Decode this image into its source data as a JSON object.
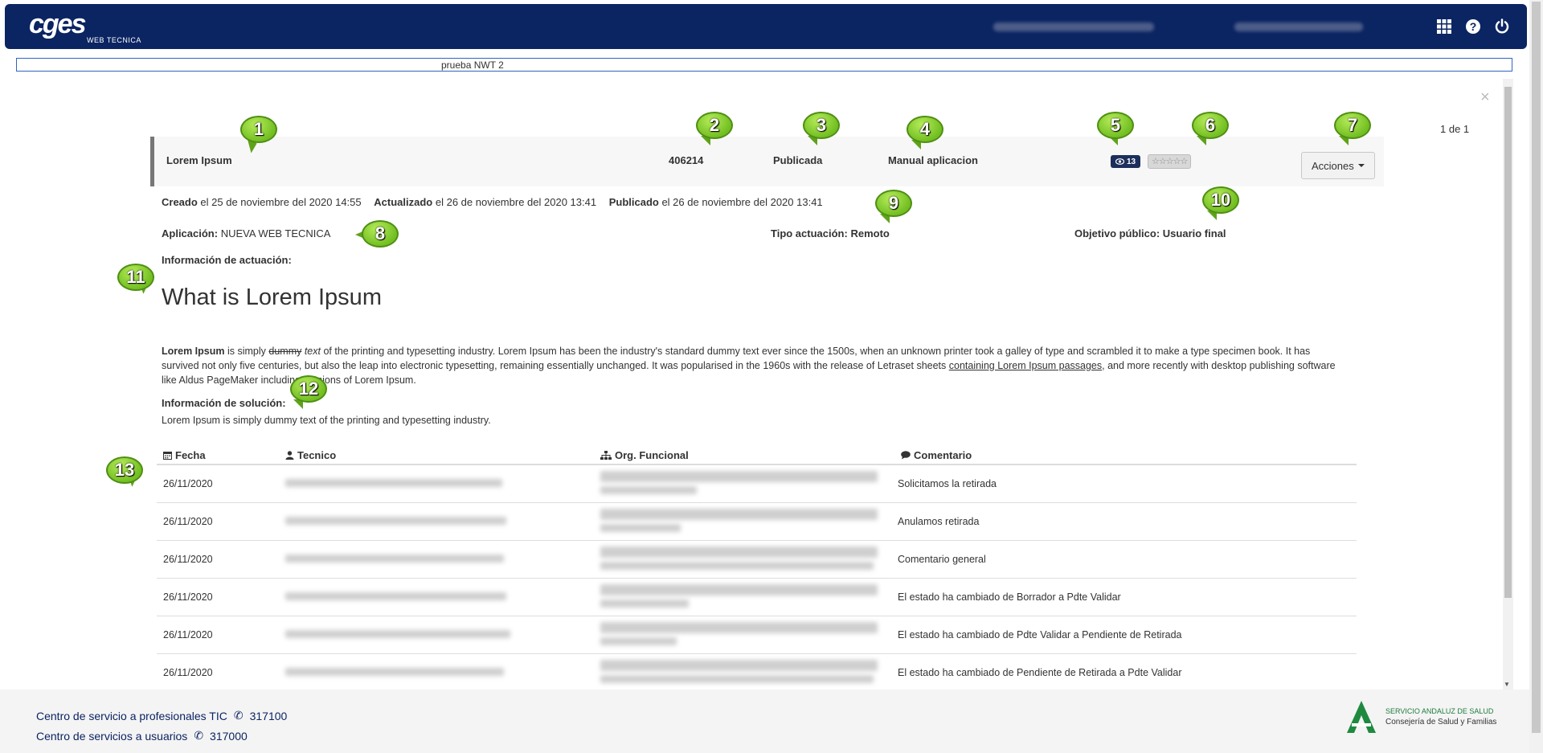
{
  "header": {
    "logo_main": "cges",
    "logo_sub": "WEB TECNICA",
    "icons": [
      "grid-icon",
      "help-icon",
      "power-icon"
    ]
  },
  "subtitle": "prueba NWT 2",
  "pager": "1 de 1",
  "close_label": "×",
  "summary": {
    "title": "Lorem Ipsum",
    "id": "406214",
    "status": "Publicada",
    "type": "Manual aplicacion",
    "views": "13",
    "stars": "☆☆☆☆☆",
    "actions_label": "Acciones"
  },
  "dates": {
    "created_label": "Creado",
    "created_value": "el 25 de noviembre del 2020 14:55",
    "updated_label": "Actualizado",
    "updated_value": "el 26 de noviembre del 2020 13:41",
    "published_label": "Publicado",
    "published_value": "el 26 de noviembre del 2020 13:41"
  },
  "fields": {
    "app_label": "Aplicación:",
    "app_value": "NUEVA WEB TECNICA",
    "tipo_label": "Tipo actuación:",
    "tipo_value": "Remoto",
    "objetivo_label": "Objetivo público:",
    "objetivo_value": "Usuario final",
    "info_actuacion_label": "Información de actuación:",
    "info_solucion_label": "Información de solución:",
    "solucion_text": "Lorem Ipsum is simply dummy text of the printing and typesetting industry."
  },
  "article": {
    "heading": "What is Lorem Ipsum",
    "bold_start": "Lorem Ipsum",
    "text1": " is simply ",
    "strike": "dummy",
    "italic": " text",
    "text2": " of the printing and typesetting industry. Lorem Ipsum has been the industry's standard dummy text ever since the 1500s, when an unknown printer took a galley of type and scrambled it to make a type specimen book. It has survived not only five centuries, but also the leap into electronic typesetting, remaining essentially unchanged. It was popularised in the 1960s with the release of Letraset sheets ",
    "link": "containing Lorem Ipsum passages",
    "text3": ", and more recently with desktop publishing software like Aldus PageMaker including versions of Lorem Ipsum."
  },
  "table": {
    "headers": {
      "fecha": "Fecha",
      "tecnico": "Tecnico",
      "org": "Org. Funcional",
      "comentario": "Comentario"
    },
    "rows": [
      {
        "fecha": "26/11/2020",
        "comentario": "Solicitamos la retirada"
      },
      {
        "fecha": "26/11/2020",
        "comentario": "Anulamos retirada"
      },
      {
        "fecha": "26/11/2020",
        "comentario": "Comentario general"
      },
      {
        "fecha": "26/11/2020",
        "comentario": "El estado ha cambiado de Borrador a Pdte Validar"
      },
      {
        "fecha": "26/11/2020",
        "comentario": "El estado ha cambiado de Pdte Validar a Pendiente de Retirada"
      },
      {
        "fecha": "26/11/2020",
        "comentario": "El estado ha cambiado de Pendiente de Retirada a Pdte Validar"
      }
    ]
  },
  "callouts": [
    "1",
    "2",
    "3",
    "4",
    "5",
    "6",
    "7",
    "8",
    "9",
    "10",
    "11",
    "12",
    "13"
  ],
  "footer": {
    "line1_text": "Centro de servicio a profesionales TIC",
    "line1_phone": "317100",
    "line2_text": "Centro de servicios a usuarios",
    "line2_phone": "317000",
    "logo_line1": "SERVICIO ANDALUZ DE SALUD",
    "logo_line2": "Consejería de Salud y Familias"
  },
  "colors": {
    "header_bg": "#0b2462",
    "callout_green": "#73bf22",
    "views_badge": "#1c2f5c"
  }
}
